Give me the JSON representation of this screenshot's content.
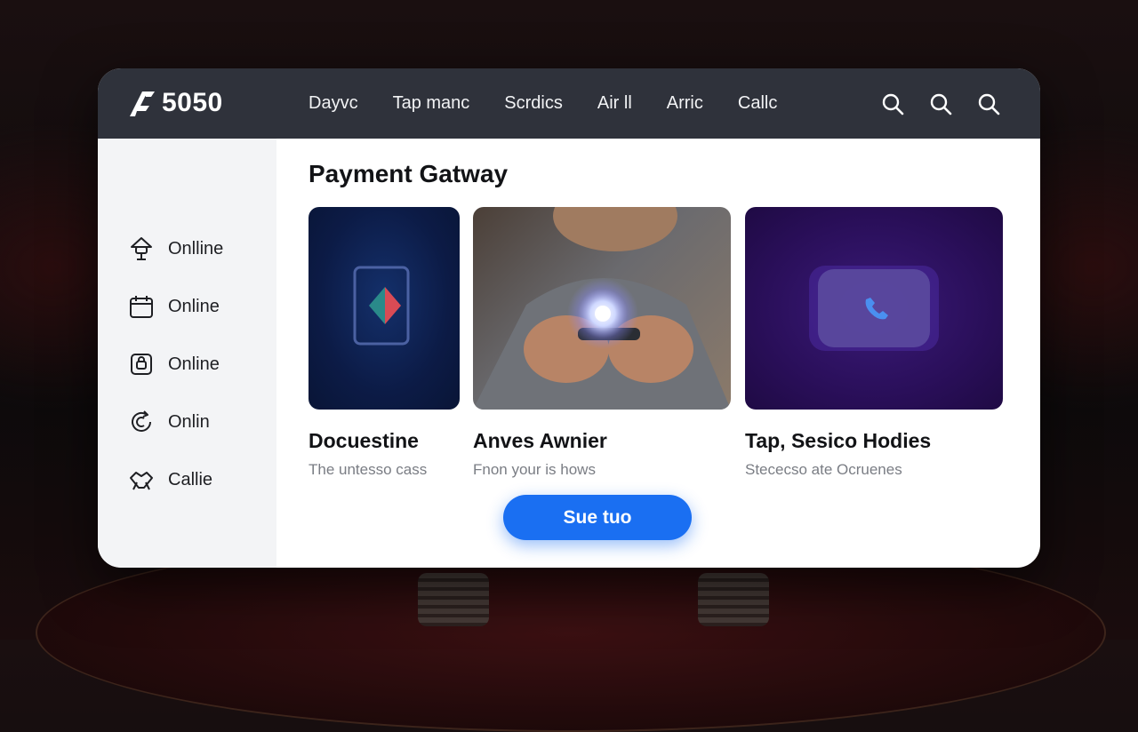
{
  "brand": {
    "name": "5050"
  },
  "nav": {
    "items": [
      "Dayvc",
      "Tap manc",
      "Scrdics",
      "Air ll",
      "Arric",
      "Callc"
    ]
  },
  "header_icons": [
    "search-icon",
    "search-icon",
    "search-icon"
  ],
  "sidebar": {
    "items": [
      {
        "label": "Onlline",
        "icon": "lamp-icon"
      },
      {
        "label": "Online",
        "icon": "calendar-icon"
      },
      {
        "label": "Online",
        "icon": "lock-icon"
      },
      {
        "label": "Onlin",
        "icon": "refresh-icon"
      },
      {
        "label": "Callie",
        "icon": "handshake-icon"
      }
    ]
  },
  "main": {
    "title": "Payment Gatway",
    "cards": [
      {
        "title": "Docuestine",
        "subtitle": "The untesso cass",
        "image": "card-terminal-image"
      },
      {
        "title": "Anves Awnier",
        "subtitle": "Fnon your is hows",
        "image": "person-holding-phone-photo"
      },
      {
        "title": "Tap, Sesico Hodies",
        "subtitle": "Stececso ate Ocruenes",
        "image": "phone-call-button-image"
      }
    ],
    "cta_label": "Sue tuo"
  },
  "colors": {
    "topbar": "#2f323b",
    "sidebar": "#f3f4f6",
    "accent": "#1a6ff2",
    "card_navy": "#0e1d4d",
    "card_purple": "#2c0f55"
  }
}
